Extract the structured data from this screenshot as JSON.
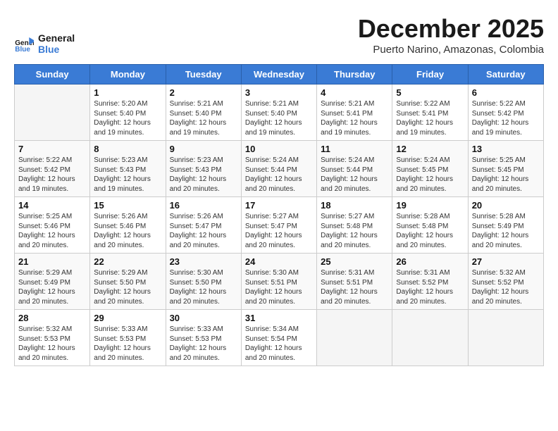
{
  "logo": {
    "line1": "General",
    "line2": "Blue"
  },
  "title": "December 2025",
  "subtitle": "Puerto Narino, Amazonas, Colombia",
  "weekdays": [
    "Sunday",
    "Monday",
    "Tuesday",
    "Wednesday",
    "Thursday",
    "Friday",
    "Saturday"
  ],
  "weeks": [
    [
      {
        "day": "",
        "empty": true
      },
      {
        "day": "1",
        "sunrise": "5:20 AM",
        "sunset": "5:40 PM",
        "daylight": "12 hours and 19 minutes."
      },
      {
        "day": "2",
        "sunrise": "5:21 AM",
        "sunset": "5:40 PM",
        "daylight": "12 hours and 19 minutes."
      },
      {
        "day": "3",
        "sunrise": "5:21 AM",
        "sunset": "5:40 PM",
        "daylight": "12 hours and 19 minutes."
      },
      {
        "day": "4",
        "sunrise": "5:21 AM",
        "sunset": "5:41 PM",
        "daylight": "12 hours and 19 minutes."
      },
      {
        "day": "5",
        "sunrise": "5:22 AM",
        "sunset": "5:41 PM",
        "daylight": "12 hours and 19 minutes."
      },
      {
        "day": "6",
        "sunrise": "5:22 AM",
        "sunset": "5:42 PM",
        "daylight": "12 hours and 19 minutes."
      }
    ],
    [
      {
        "day": "7",
        "sunrise": "5:22 AM",
        "sunset": "5:42 PM",
        "daylight": "12 hours and 19 minutes."
      },
      {
        "day": "8",
        "sunrise": "5:23 AM",
        "sunset": "5:43 PM",
        "daylight": "12 hours and 19 minutes."
      },
      {
        "day": "9",
        "sunrise": "5:23 AM",
        "sunset": "5:43 PM",
        "daylight": "12 hours and 20 minutes."
      },
      {
        "day": "10",
        "sunrise": "5:24 AM",
        "sunset": "5:44 PM",
        "daylight": "12 hours and 20 minutes."
      },
      {
        "day": "11",
        "sunrise": "5:24 AM",
        "sunset": "5:44 PM",
        "daylight": "12 hours and 20 minutes."
      },
      {
        "day": "12",
        "sunrise": "5:24 AM",
        "sunset": "5:45 PM",
        "daylight": "12 hours and 20 minutes."
      },
      {
        "day": "13",
        "sunrise": "5:25 AM",
        "sunset": "5:45 PM",
        "daylight": "12 hours and 20 minutes."
      }
    ],
    [
      {
        "day": "14",
        "sunrise": "5:25 AM",
        "sunset": "5:46 PM",
        "daylight": "12 hours and 20 minutes."
      },
      {
        "day": "15",
        "sunrise": "5:26 AM",
        "sunset": "5:46 PM",
        "daylight": "12 hours and 20 minutes."
      },
      {
        "day": "16",
        "sunrise": "5:26 AM",
        "sunset": "5:47 PM",
        "daylight": "12 hours and 20 minutes."
      },
      {
        "day": "17",
        "sunrise": "5:27 AM",
        "sunset": "5:47 PM",
        "daylight": "12 hours and 20 minutes."
      },
      {
        "day": "18",
        "sunrise": "5:27 AM",
        "sunset": "5:48 PM",
        "daylight": "12 hours and 20 minutes."
      },
      {
        "day": "19",
        "sunrise": "5:28 AM",
        "sunset": "5:48 PM",
        "daylight": "12 hours and 20 minutes."
      },
      {
        "day": "20",
        "sunrise": "5:28 AM",
        "sunset": "5:49 PM",
        "daylight": "12 hours and 20 minutes."
      }
    ],
    [
      {
        "day": "21",
        "sunrise": "5:29 AM",
        "sunset": "5:49 PM",
        "daylight": "12 hours and 20 minutes."
      },
      {
        "day": "22",
        "sunrise": "5:29 AM",
        "sunset": "5:50 PM",
        "daylight": "12 hours and 20 minutes."
      },
      {
        "day": "23",
        "sunrise": "5:30 AM",
        "sunset": "5:50 PM",
        "daylight": "12 hours and 20 minutes."
      },
      {
        "day": "24",
        "sunrise": "5:30 AM",
        "sunset": "5:51 PM",
        "daylight": "12 hours and 20 minutes."
      },
      {
        "day": "25",
        "sunrise": "5:31 AM",
        "sunset": "5:51 PM",
        "daylight": "12 hours and 20 minutes."
      },
      {
        "day": "26",
        "sunrise": "5:31 AM",
        "sunset": "5:52 PM",
        "daylight": "12 hours and 20 minutes."
      },
      {
        "day": "27",
        "sunrise": "5:32 AM",
        "sunset": "5:52 PM",
        "daylight": "12 hours and 20 minutes."
      }
    ],
    [
      {
        "day": "28",
        "sunrise": "5:32 AM",
        "sunset": "5:53 PM",
        "daylight": "12 hours and 20 minutes."
      },
      {
        "day": "29",
        "sunrise": "5:33 AM",
        "sunset": "5:53 PM",
        "daylight": "12 hours and 20 minutes."
      },
      {
        "day": "30",
        "sunrise": "5:33 AM",
        "sunset": "5:53 PM",
        "daylight": "12 hours and 20 minutes."
      },
      {
        "day": "31",
        "sunrise": "5:34 AM",
        "sunset": "5:54 PM",
        "daylight": "12 hours and 20 minutes."
      },
      {
        "day": "",
        "empty": true
      },
      {
        "day": "",
        "empty": true
      },
      {
        "day": "",
        "empty": true
      }
    ]
  ]
}
